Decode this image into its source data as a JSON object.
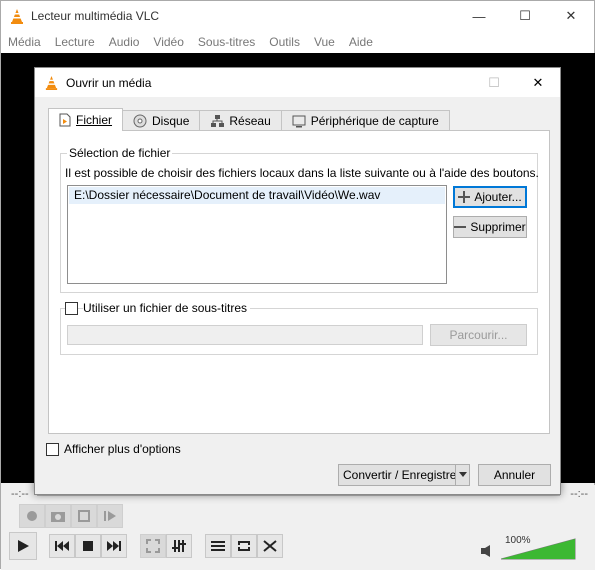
{
  "app": {
    "title": "Lecteur multimédia VLC",
    "menu": [
      "Média",
      "Lecture",
      "Audio",
      "Vidéo",
      "Sous-titres",
      "Outils",
      "Vue",
      "Aide"
    ]
  },
  "seek": {
    "time_left": "--:--",
    "time_right": "--:--"
  },
  "volume": {
    "label": "100%",
    "level": 1.0
  },
  "dialog": {
    "title": "Ouvrir un média",
    "tabs": [
      {
        "label": "Fichier",
        "active": true
      },
      {
        "label": "Disque"
      },
      {
        "label": "Réseau"
      },
      {
        "label": "Périphérique de capture"
      }
    ],
    "file_selection": {
      "legend": "Sélection de fichier",
      "note": "Il est possible de choisir des fichiers locaux dans la liste suivante ou à l'aide des boutons.",
      "files": [
        "E:\\Dossier nécessaire\\Document de travail\\Vidéo\\We.wav"
      ],
      "add_label": "Ajouter...",
      "remove_label": "Supprimer"
    },
    "subtitles": {
      "checkbox_label": "Utiliser un fichier de sous-titres",
      "checked": false,
      "path_value": "",
      "browse_label": "Parcourir..."
    },
    "more_options_label": "Afficher plus d'options",
    "convert_label": "Convertir / Enregistrer",
    "cancel_label": "Annuler"
  },
  "colors": {
    "vlc_orange": "#f28c0f",
    "accent": "#0078d7",
    "volume_green": "#3cb832"
  }
}
